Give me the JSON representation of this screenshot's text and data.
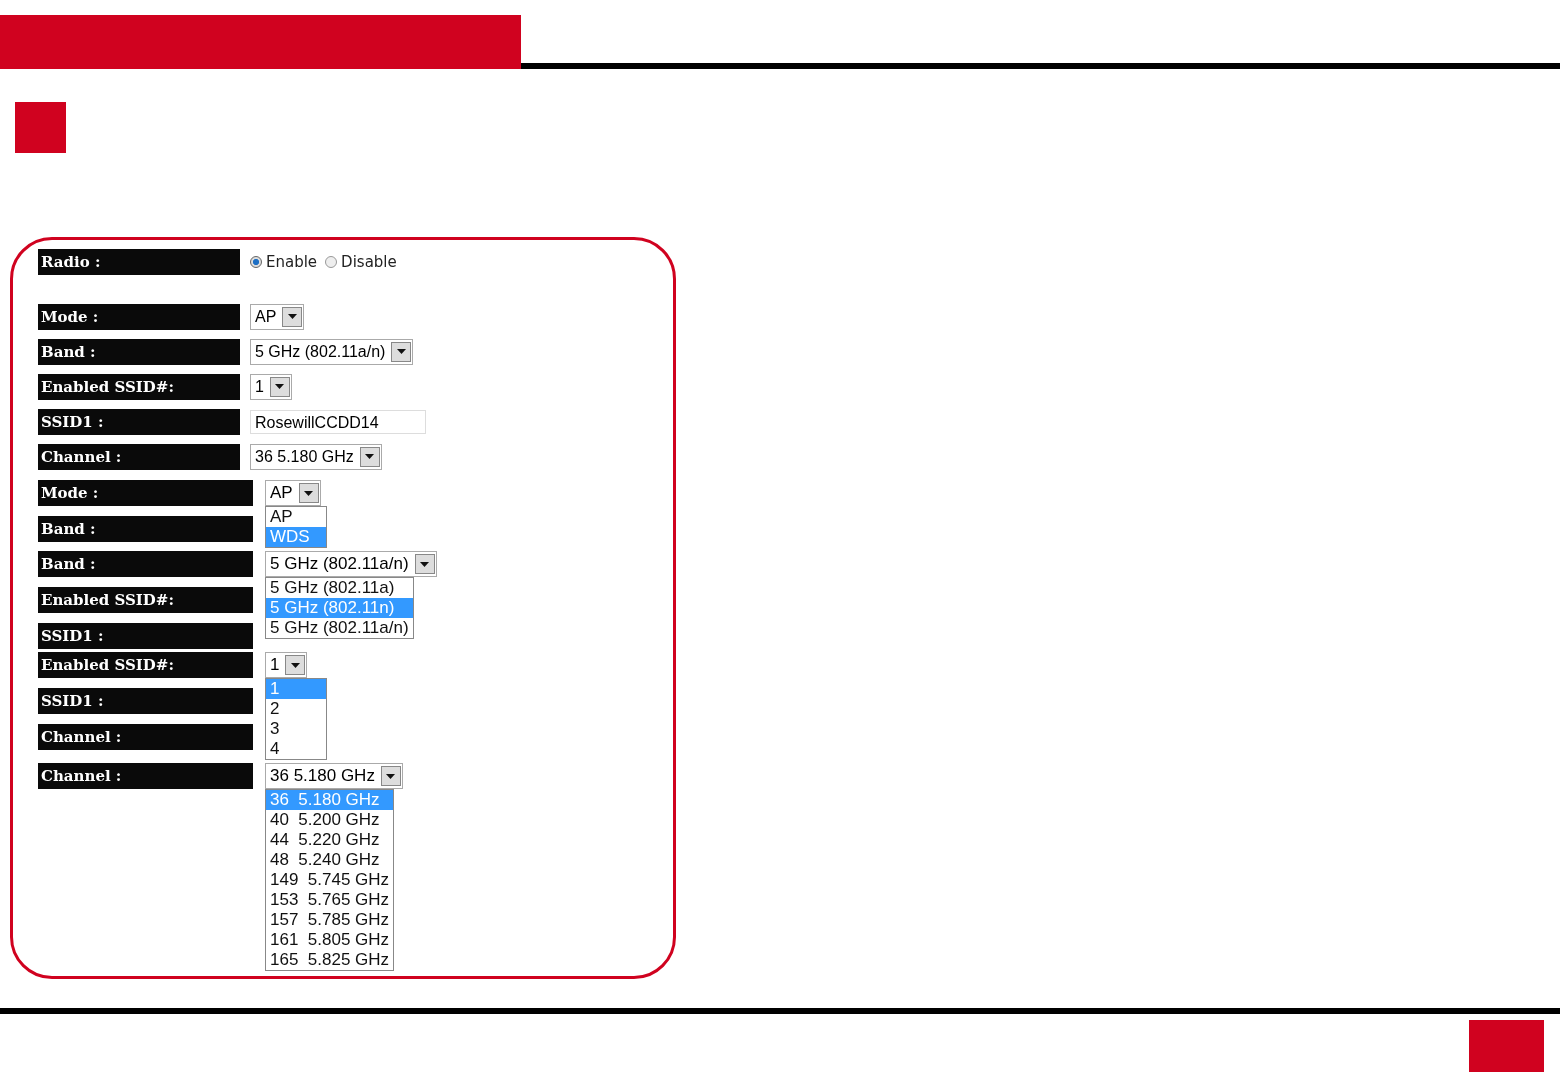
{
  "form": {
    "rows": [
      {
        "label": "Radio :",
        "kind": "radio",
        "options": [
          {
            "label": "Enable",
            "selected": true
          },
          {
            "label": "Disable",
            "selected": false
          }
        ]
      },
      {
        "label": "Mode :",
        "kind": "select",
        "value": "AP"
      },
      {
        "label": "Band :",
        "kind": "select",
        "value": "5 GHz (802.11a/n)"
      },
      {
        "label": "Enabled SSID#:",
        "kind": "select",
        "value": "1"
      },
      {
        "label": "SSID1 :",
        "kind": "text",
        "value": "RosewillCCDD14"
      },
      {
        "label": "Channel :",
        "kind": "select",
        "value": "36  5.180 GHz"
      }
    ]
  },
  "dropdowns": [
    {
      "labels": [
        "Mode :",
        "Band :"
      ],
      "value": "AP",
      "options": [
        {
          "label": "AP",
          "highlighted": false
        },
        {
          "label": "WDS",
          "highlighted": true
        }
      ]
    },
    {
      "labels": [
        "Band :",
        "Enabled SSID#:",
        "SSID1 :"
      ],
      "value": "5 GHz (802.11a/n)",
      "options": [
        {
          "label": "5 GHz (802.11a)",
          "highlighted": false
        },
        {
          "label": "5 GHz (802.11n)",
          "highlighted": true
        },
        {
          "label": "5 GHz (802.11a/n)",
          "highlighted": false
        }
      ]
    },
    {
      "labels": [
        "Enabled SSID#:",
        "SSID1 :",
        "Channel :"
      ],
      "value": "1",
      "options": [
        {
          "label": "1",
          "highlighted": true
        },
        {
          "label": "2",
          "highlighted": false
        },
        {
          "label": "3",
          "highlighted": false
        },
        {
          "label": "4",
          "highlighted": false
        }
      ]
    },
    {
      "labels": [
        "Channel :"
      ],
      "value": "36  5.180 GHz",
      "options": [
        {
          "label": "36  5.180 GHz",
          "highlighted": true
        },
        {
          "label": "40  5.200 GHz",
          "highlighted": false
        },
        {
          "label": "44  5.220 GHz",
          "highlighted": false
        },
        {
          "label": "48  5.240 GHz",
          "highlighted": false
        },
        {
          "label": "149  5.745 GHz",
          "highlighted": false
        },
        {
          "label": "153  5.765 GHz",
          "highlighted": false
        },
        {
          "label": "157  5.785 GHz",
          "highlighted": false
        },
        {
          "label": "161  5.805 GHz",
          "highlighted": false
        },
        {
          "label": "165  5.825 GHz",
          "highlighted": false
        }
      ]
    }
  ]
}
